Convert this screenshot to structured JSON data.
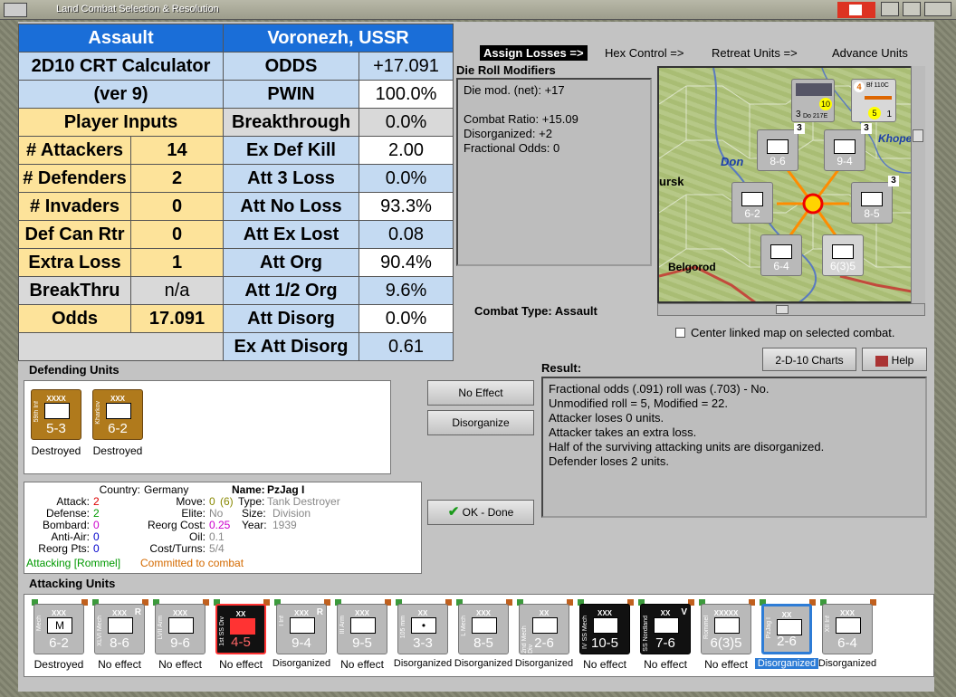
{
  "window": {
    "title": "Land Combat Selection & Resolution"
  },
  "calc": {
    "header_left": "Assault",
    "header_right": "Voronezh, USSR",
    "calc_title": "2D10 CRT Calculator",
    "calc_version": "(ver 9)",
    "player_inputs": "Player Inputs",
    "left_rows": [
      {
        "label": "# Attackers",
        "value": "14"
      },
      {
        "label": "# Defenders",
        "value": "2"
      },
      {
        "label": "# Invaders",
        "value": "0"
      },
      {
        "label": "Def Can Rtr",
        "value": "0"
      },
      {
        "label": "Extra Loss",
        "value": "1"
      },
      {
        "label": "BreakThru",
        "value": "n/a"
      },
      {
        "label": "Odds",
        "value": "17.091"
      }
    ],
    "right_rows": [
      {
        "label": "ODDS",
        "value": "+17.091"
      },
      {
        "label": "PWIN",
        "value": "100.0%"
      },
      {
        "label": "Breakthrough",
        "value": "0.0%"
      },
      {
        "label": "Ex Def Kill",
        "value": "2.00"
      },
      {
        "label": "Att 3 Loss",
        "value": "0.0%"
      },
      {
        "label": "Att No Loss",
        "value": "93.3%"
      },
      {
        "label": "Att Ex Lost",
        "value": "0.08"
      },
      {
        "label": "Att Org",
        "value": "90.4%"
      },
      {
        "label": "Att 1/2 Org",
        "value": "9.6%"
      },
      {
        "label": "Att Disorg",
        "value": "0.0%"
      },
      {
        "label": "Ex Att Disorg",
        "value": "0.61"
      }
    ]
  },
  "tabs": {
    "assign_losses": "Assign Losses =>",
    "hex_control": "Hex Control =>",
    "retreat_units": "Retreat Units =>",
    "advance_units": "Advance Units"
  },
  "die_roll": {
    "title": "Die Roll Modifiers",
    "text": "Die mod. (net): +17\n\nCombat Ratio: +15.09\nDisorganized: +2\nFractional Odds: 0"
  },
  "combat_type": {
    "label": "Combat Type:",
    "value": "Assault"
  },
  "map": {
    "labels": {
      "don": "Don",
      "ursk": "ursk",
      "belgorod": "Belgorod",
      "khope": "Khope"
    },
    "units": [
      {
        "name": "XXIV Mech",
        "str": "8-6",
        "num": "3"
      },
      {
        "name": "Mech",
        "str": "9-4",
        "num": "3"
      },
      {
        "name": "Motor",
        "str": "6-2"
      },
      {
        "name": "Mech",
        "str": "8-5",
        "num": "3"
      },
      {
        "name": "XIII Inf",
        "str": "6-4"
      },
      {
        "name": "Cav",
        "str": "6(3)5"
      }
    ],
    "air": [
      {
        "name": "Do 217E",
        "str": "3",
        "num": "10"
      },
      {
        "name": "Bf 110C",
        "str": "1",
        "num": "5",
        "top": "4"
      }
    ]
  },
  "center_map": "Center linked map on selected combat.",
  "buttons": {
    "charts": "2-D-10 Charts",
    "help": "Help",
    "no_effect": "No Effect",
    "disorganize": "Disorganize",
    "ok_done": "OK - Done"
  },
  "defending": {
    "title": "Defending Units",
    "units": [
      {
        "name": "59th Inf",
        "hdr": "XXXX",
        "str": "5-3",
        "status": "Destroyed"
      },
      {
        "name": "Kharkov",
        "hdr": "XXX",
        "str": "6-2",
        "status": "Destroyed"
      }
    ]
  },
  "result": {
    "title": "Result:",
    "text": "Fractional odds (.091) roll was (.703)  - No.\nUnmodified roll = 5, Modified = 22.\nAttacker loses 0 units.\nAttacker takes an extra loss.\nHalf of the surviving attacking units are disorganized.\nDefender loses 2 units."
  },
  "info": {
    "country_label": "Country:",
    "country": "Germany",
    "attack_label": "Attack:",
    "attack": "2",
    "defense_label": "Defense:",
    "defense": "2",
    "bombard_label": "Bombard:",
    "bombard": "0",
    "antiair_label": "Anti-Air:",
    "antiair": "0",
    "reorgpts_label": "Reorg Pts:",
    "reorgpts": "0",
    "move_label": "Move:",
    "move": "0",
    "move_paren": "(6)",
    "elite_label": "Elite:",
    "elite": "No",
    "reorgcost_label": "Reorg Cost:",
    "reorgcost": "0.25",
    "oil_label": "Oil:",
    "oil": "0.1",
    "costturns_label": "Cost/Turns:",
    "costturns": "5/4",
    "name_label": "Name:",
    "name": "PzJag I",
    "type_label": "Type:",
    "type": "Tank Destroyer",
    "size_label": "Size:",
    "size": "Division",
    "year_label": "Year:",
    "year": "1939",
    "attacking_hq": "Attacking [Rommel]",
    "committed": "Committed to combat"
  },
  "attacking": {
    "title": "Attacking Units",
    "units": [
      {
        "name": "Mech",
        "hdr": "XXX",
        "str": "6-2",
        "status": "Destroyed",
        "style": "gray",
        "sym": "M"
      },
      {
        "name": "XLVI Mech",
        "hdr": "XXX",
        "str": "8-6",
        "status": "No effect",
        "style": "gray",
        "sym": "",
        "mark": "R"
      },
      {
        "name": "LVII Arm",
        "hdr": "XXX",
        "str": "9-6",
        "status": "No effect",
        "style": "gray",
        "sym": ""
      },
      {
        "name": "1st SS Div",
        "hdr": "XX",
        "str": "4-5",
        "status": "No effect",
        "style": "red",
        "sym": ""
      },
      {
        "name": "I Inf",
        "hdr": "XXX",
        "str": "9-4",
        "status": "Disorganized",
        "style": "gray",
        "sym": "",
        "mark": "R"
      },
      {
        "name": "III Arm",
        "hdr": "XXX",
        "str": "9-5",
        "status": "No effect",
        "style": "gray",
        "sym": ""
      },
      {
        "name": "105 mm",
        "hdr": "XX",
        "str": "3-3",
        "status": "Disorganized",
        "style": "gray",
        "sym": "•"
      },
      {
        "name": "L Mech",
        "hdr": "XXX",
        "str": "8-5",
        "status": "Disorganized",
        "style": "gray",
        "sym": ""
      },
      {
        "name": "2nd Mech Div",
        "hdr": "XX",
        "str": "2-6",
        "status": "Disorganized",
        "style": "gray",
        "sym": ""
      },
      {
        "name": "IV SS Mech",
        "hdr": "XXX",
        "str": "10-5",
        "status": "No effect",
        "style": "black",
        "sym": ""
      },
      {
        "name": "SS Nordland",
        "hdr": "XX",
        "str": "7-6",
        "status": "No effect",
        "style": "black",
        "sym": "",
        "mark": "V"
      },
      {
        "name": "Rommel",
        "hdr": "XXXXX",
        "str": "6(3)5",
        "status": "No effect",
        "style": "gray",
        "sym": ""
      },
      {
        "name": "PzJag I",
        "hdr": "XX",
        "str": "2-6",
        "status": "Disorganized",
        "style": "sel",
        "sym": ""
      },
      {
        "name": "XII Inf",
        "hdr": "XXX",
        "str": "6-4",
        "status": "Disorganized",
        "style": "gray",
        "sym": ""
      }
    ]
  }
}
